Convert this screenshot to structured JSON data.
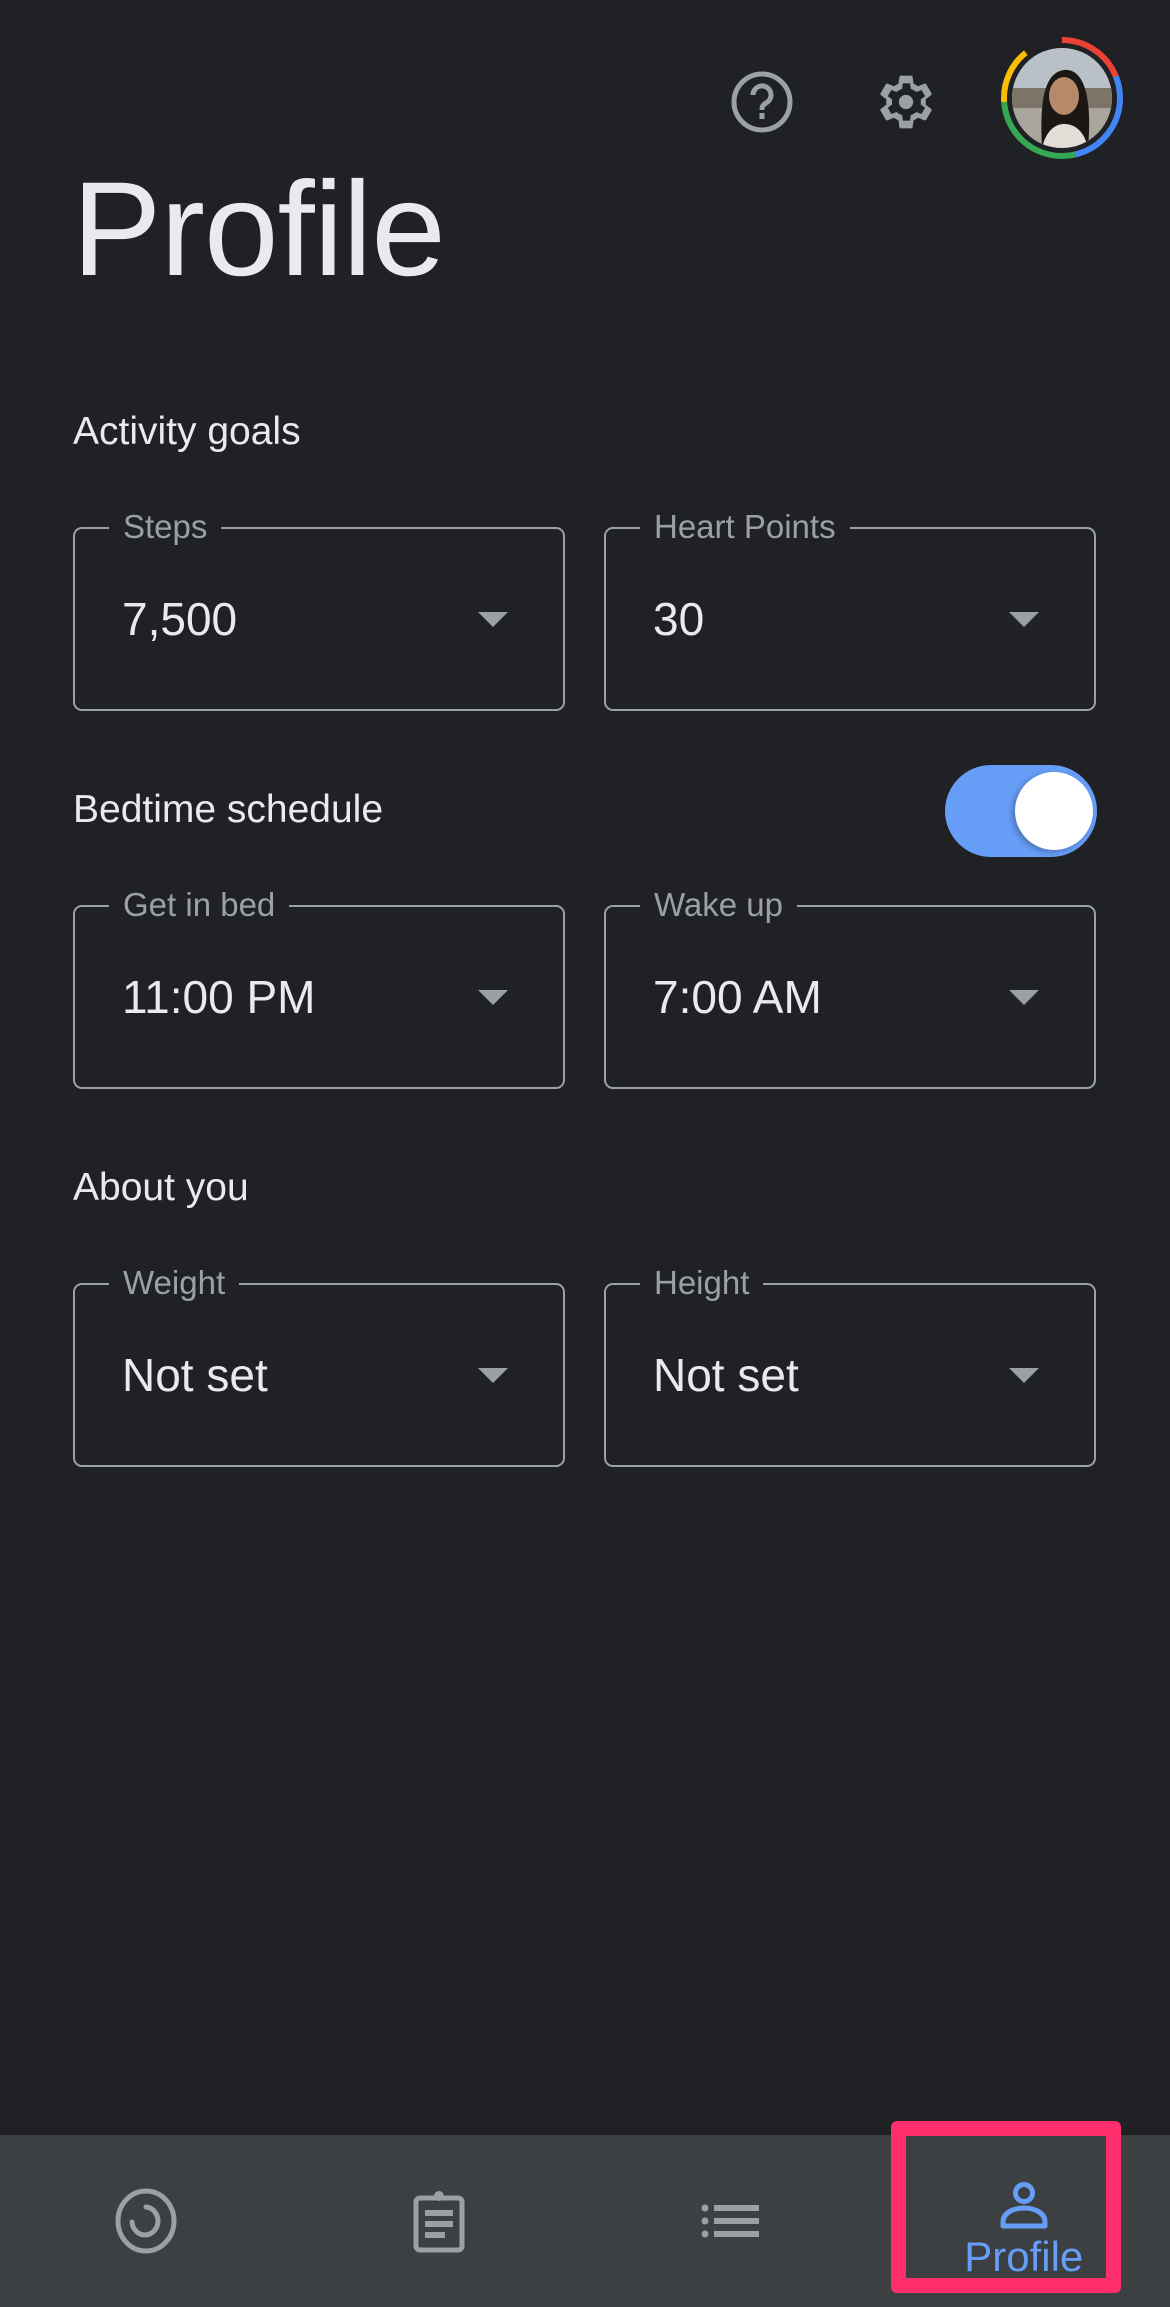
{
  "header": {
    "title": "Profile",
    "actions": [
      {
        "name": "help",
        "icon": "help-circle-icon"
      },
      {
        "name": "settings",
        "icon": "gear-icon"
      },
      {
        "name": "account",
        "icon": "avatar"
      }
    ]
  },
  "sections": {
    "activity_goals": {
      "title": "Activity goals",
      "fields": [
        {
          "label": "Steps",
          "value": "7,500"
        },
        {
          "label": "Heart Points",
          "value": "30"
        }
      ]
    },
    "bedtime_schedule": {
      "title": "Bedtime schedule",
      "toggle_on": true,
      "fields": [
        {
          "label": "Get in bed",
          "value": "11:00 PM"
        },
        {
          "label": "Wake up",
          "value": "7:00 AM"
        }
      ]
    },
    "about_you": {
      "title": "About you",
      "fields": [
        {
          "label": "Weight",
          "value": "Not set"
        },
        {
          "label": "Height",
          "value": "Not set"
        }
      ]
    }
  },
  "bottom_nav": {
    "items": [
      {
        "name": "home",
        "icon": "activity-ring-icon",
        "label": ""
      },
      {
        "name": "journal",
        "icon": "clipboard-icon",
        "label": ""
      },
      {
        "name": "browse",
        "icon": "list-icon",
        "label": ""
      },
      {
        "name": "profile",
        "icon": "person-icon",
        "label": "Profile",
        "active": true
      }
    ]
  },
  "colors": {
    "background": "#202124",
    "nav_background": "#3c4043",
    "accent": "#669df6",
    "highlight": "#ff2d6b",
    "text_primary": "#e8eaed",
    "text_secondary": "#9aa0a6"
  }
}
